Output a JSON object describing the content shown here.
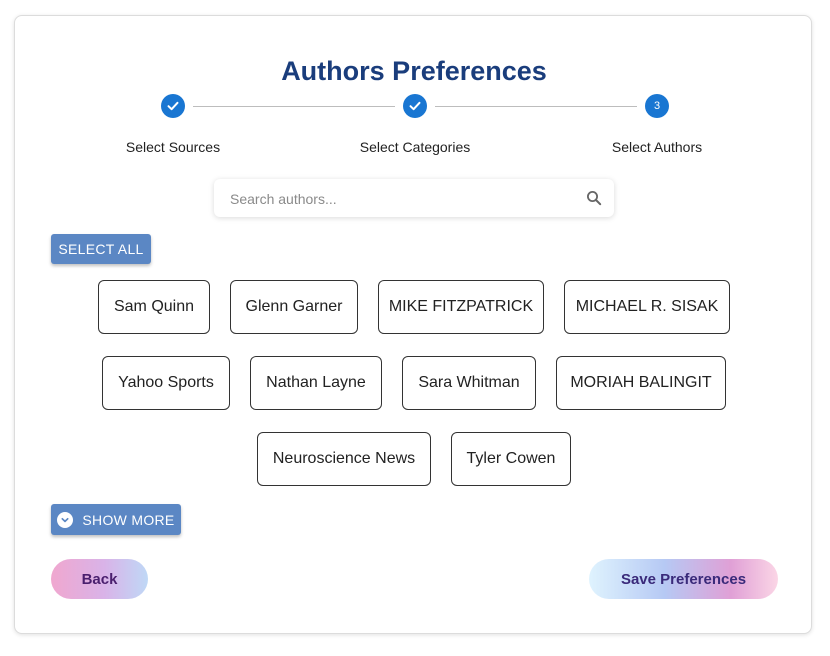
{
  "page": {
    "title": "Authors Preferences"
  },
  "stepper": {
    "steps": [
      {
        "label": "Select Sources",
        "state": "completed",
        "icon": "check-icon"
      },
      {
        "label": "Select Categories",
        "state": "completed",
        "icon": "check-icon"
      },
      {
        "label": "Select Authors",
        "state": "active",
        "number": "3"
      }
    ]
  },
  "search": {
    "placeholder": "Search authors...",
    "value": "",
    "icon": "search-icon"
  },
  "select_all_label": "SELECT ALL",
  "authors": [
    "Sam Quinn",
    "Glenn Garner",
    "MIKE FITZPATRICK",
    "MICHAEL R. SISAK",
    "Yahoo Sports",
    "Nathan Layne",
    "Sara Whitman",
    "MORIAH BALINGIT",
    "Neuroscience News",
    "Tyler Cowen"
  ],
  "show_more_label": "SHOW MORE",
  "show_more_icon": "chevron-down-icon",
  "footer": {
    "back_label": "Back",
    "save_label": "Save Preferences"
  },
  "colors": {
    "title": "#1a3d7c",
    "step_active": "#1976d2",
    "button_blue": "#5b87c4"
  }
}
